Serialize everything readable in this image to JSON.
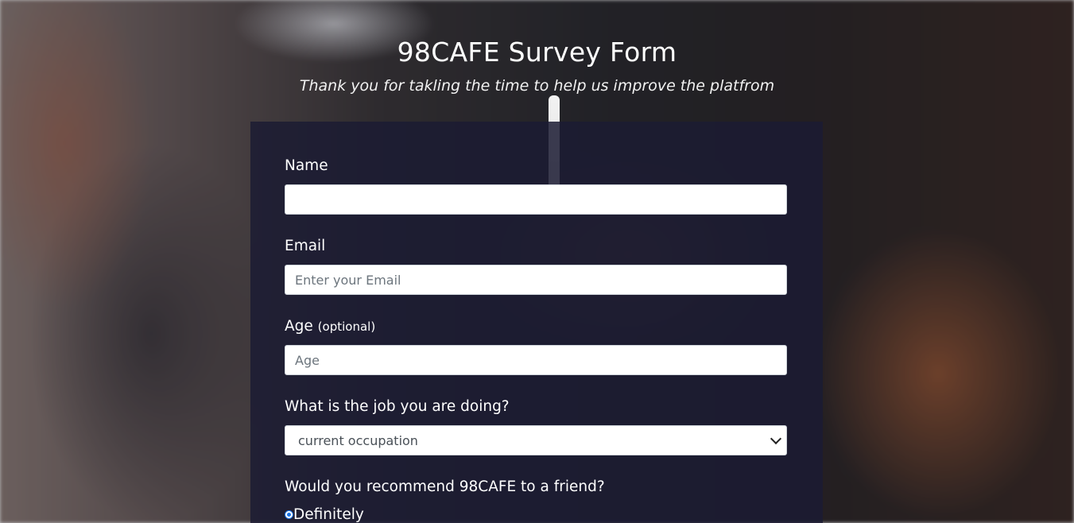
{
  "header": {
    "title": "98CAFE Survey Form",
    "description": "Thank you for takling the time to help us improve the platfrom"
  },
  "form": {
    "name": {
      "label": "Name",
      "value": "",
      "placeholder": ""
    },
    "email": {
      "label": "Email",
      "value": "",
      "placeholder": "Enter your Email"
    },
    "age": {
      "label": "Age",
      "label_suffix": "(optional)",
      "value": "",
      "placeholder": "Age"
    },
    "job": {
      "label": "What is the job you are doing?",
      "selected": "current occupation"
    },
    "recommend": {
      "label": "Would you recommend 98CAFE to a friend?",
      "options": [
        "Definitely"
      ]
    }
  },
  "colors": {
    "form_background": "#1b1b32",
    "text": "#ffffff",
    "radio_accent": "#1a73e8"
  }
}
